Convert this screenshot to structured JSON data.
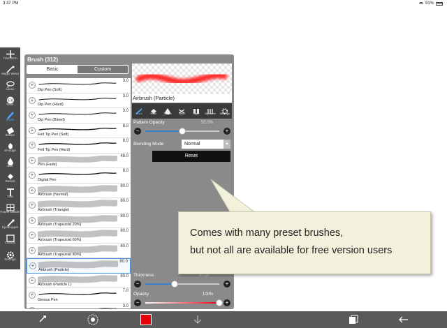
{
  "status": {
    "time": "3:47 PM",
    "battery": "91%"
  },
  "toolbar": {
    "items": [
      {
        "label": "Transform",
        "icon": "transform-icon"
      },
      {
        "label": "Magic Wand",
        "icon": "magic-wand-icon"
      },
      {
        "label": "Lasso",
        "icon": "lasso-icon"
      },
      {
        "label": "Filter",
        "icon": "fx-icon"
      },
      {
        "label": "Brush",
        "icon": "brush-icon"
      },
      {
        "label": "Eraser",
        "icon": "eraser-icon"
      },
      {
        "label": "Smudge",
        "icon": "smudge-icon"
      },
      {
        "label": "Blur",
        "icon": "blur-icon"
      },
      {
        "label": "Bucket",
        "icon": "bucket-icon"
      },
      {
        "label": "Text",
        "icon": "text-icon"
      },
      {
        "label": "Frame Divider",
        "icon": "frame-divider-icon"
      },
      {
        "label": "Eyedropper",
        "icon": "eyedropper-icon"
      },
      {
        "label": "Canvas",
        "icon": "canvas-icon"
      },
      {
        "label": "Settings",
        "icon": "gear-icon"
      }
    ]
  },
  "panel": {
    "title": "Brush (312)",
    "tabs": {
      "basic": "Basic",
      "custom": "Custom"
    },
    "brushes": [
      {
        "name": "Dip Pen (Soft)",
        "size": "3.0"
      },
      {
        "name": "Dip Pen (Hard)",
        "size": "3.0"
      },
      {
        "name": "Dip Pen (Bleed)",
        "size": "3.0"
      },
      {
        "name": "Felt Tip Pen (Soft)",
        "size": "8.0"
      },
      {
        "name": "Felt Tip Pen (Hard)",
        "size": "8.0"
      },
      {
        "name": "Pen (Fade)",
        "size": "48.0"
      },
      {
        "name": "Digital Pen",
        "size": "8.0"
      },
      {
        "name": "Airbrush (Normal)",
        "size": "80.0"
      },
      {
        "name": "Airbrush (Triangle)",
        "size": "80.0"
      },
      {
        "name": "Airbrush (Trapezoid 20%)",
        "size": "80.0"
      },
      {
        "name": "Airbrush (Trapezoid 60%)",
        "size": "80.0"
      },
      {
        "name": "Airbrush (Trapezoid 80%)",
        "size": "80.0"
      },
      {
        "name": "Airbrush (Particle)",
        "size": "80.0"
      },
      {
        "name": "Airbrush (Particle L)",
        "size": "80.0"
      },
      {
        "name": "Genius Pen",
        "size": "7.0"
      },
      {
        "name": "",
        "size": "3.0"
      }
    ],
    "preview_name": "Airbrush (Particle)",
    "prop_tabs": [
      "Band",
      "Halo",
      "Shape",
      "Jitter",
      "Type",
      "Dynamic",
      "Settings"
    ],
    "pattern_opacity": {
      "label": "Pattern Opacity",
      "value": "50.0%",
      "fraction": 0.5
    },
    "blending_mode": {
      "label": "Blending Mode",
      "value": "Normal"
    },
    "reset_label": "Reset",
    "thickness": {
      "label": "Thickness",
      "value": "80 px",
      "fraction": 0.4
    },
    "opacity": {
      "label": "Opacity",
      "value": "100%",
      "fraction": 1.0
    }
  },
  "callout": {
    "line1": "Comes with many preset brushes,",
    "line2": "but not all are available for free version users"
  },
  "colors": {
    "accent": "#3d7fc4",
    "current_color": "#e8000b"
  }
}
